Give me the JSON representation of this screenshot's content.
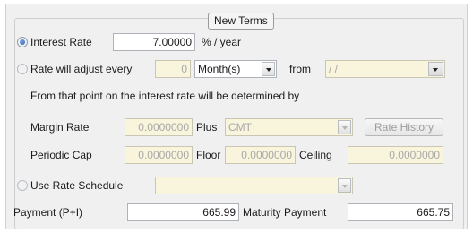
{
  "section_title": "New Terms",
  "interest_rate": {
    "label": "Interest Rate",
    "value": "7.00000",
    "unit": "% / year",
    "selected": true
  },
  "rate_adjust": {
    "label": "Rate will adjust every",
    "count": "0",
    "period": "Month(s)",
    "from_label": "from",
    "from_date": "/ /"
  },
  "info_text": "From that point on the interest rate will be determined by",
  "margin": {
    "label": "Margin Rate",
    "value": "0.0000000",
    "plus_label": "Plus",
    "index_value": "CMT",
    "history_button": "Rate History"
  },
  "caps": {
    "periodic_label": "Periodic Cap",
    "periodic_value": "0.0000000",
    "floor_label": "Floor",
    "floor_value": "0.0000000",
    "ceiling_label": "Ceiling",
    "ceiling_value": "0.0000000"
  },
  "schedule": {
    "label": "Use Rate Schedule",
    "value": ""
  },
  "payment": {
    "label": "Payment (P+I)",
    "value": "665.99",
    "maturity_label": "Maturity Payment",
    "maturity_value": "665.75"
  }
}
